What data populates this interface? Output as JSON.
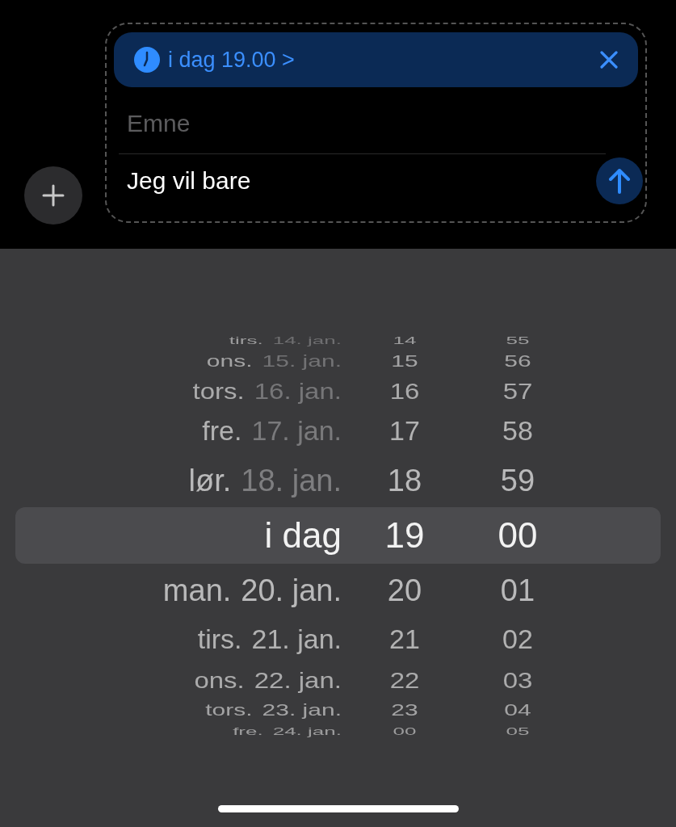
{
  "composer": {
    "schedule_chip": {
      "label": "i dag 19.00 >"
    },
    "subject": {
      "placeholder": "Emne"
    },
    "message": {
      "value": "Jeg vil bare"
    }
  },
  "picker": {
    "rows": [
      {
        "day": "tirs.",
        "date": "14. jan.",
        "hour": "14",
        "minute": "55",
        "past": true,
        "selected": false
      },
      {
        "day": "ons.",
        "date": "15. jan.",
        "hour": "15",
        "minute": "56",
        "past": true,
        "selected": false
      },
      {
        "day": "tors.",
        "date": "16. jan.",
        "hour": "16",
        "minute": "57",
        "past": true,
        "selected": false
      },
      {
        "day": "fre.",
        "date": "17. jan.",
        "hour": "17",
        "minute": "58",
        "past": true,
        "selected": false
      },
      {
        "day": "lør.",
        "date": "18. jan.",
        "hour": "18",
        "minute": "59",
        "past": true,
        "selected": false
      },
      {
        "day": "i dag",
        "hour": "19",
        "minute": "00",
        "selected": true
      },
      {
        "day": "man.",
        "date": "20. jan.",
        "hour": "20",
        "minute": "01",
        "past": false,
        "selected": false
      },
      {
        "day": "tirs.",
        "date": "21. jan.",
        "hour": "21",
        "minute": "02",
        "past": false,
        "selected": false
      },
      {
        "day": "ons.",
        "date": "22. jan.",
        "hour": "22",
        "minute": "03",
        "past": false,
        "selected": false
      },
      {
        "day": "tors.",
        "date": "23. jan.",
        "hour": "23",
        "minute": "04",
        "past": false,
        "selected": false
      },
      {
        "day": "fre.",
        "date": "24. jan.",
        "hour": "00",
        "minute": "05",
        "past": false,
        "selected": false
      }
    ]
  }
}
